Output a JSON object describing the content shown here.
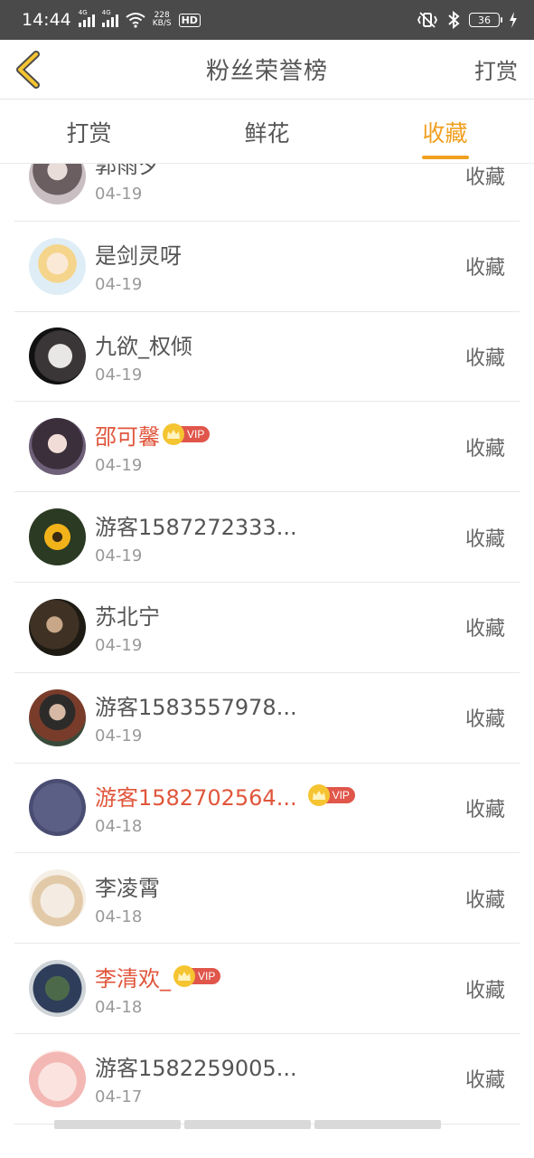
{
  "status_bar": {
    "time": "14:44",
    "sim1": "4G",
    "sim2": "4G",
    "speed_value": "228",
    "speed_unit": "KB/S",
    "hd_label": "HD",
    "battery": "36",
    "icons": [
      "signal-icon",
      "signal-icon",
      "wifi-icon",
      "vibrate-icon",
      "bluetooth-icon",
      "battery-icon",
      "charging-icon"
    ]
  },
  "header": {
    "title": "粉丝荣誉榜",
    "action": "打赏",
    "back_icon": "chevron-left-icon",
    "accent": "#f0a020"
  },
  "tabs": [
    {
      "label": "打赏",
      "active": false
    },
    {
      "label": "鲜花",
      "active": false
    },
    {
      "label": "收藏",
      "active": true
    }
  ],
  "vip_label": "VIP",
  "vip_name_color": "#e0563b",
  "rows": [
    {
      "name": "郭雨夕",
      "date": "04-19",
      "action": "收藏",
      "vip": false
    },
    {
      "name": "是剑灵呀",
      "date": "04-19",
      "action": "收藏",
      "vip": false
    },
    {
      "name": "九欲_权倾",
      "date": "04-19",
      "action": "收藏",
      "vip": false
    },
    {
      "name": "邵可馨",
      "date": "04-19",
      "action": "收藏",
      "vip": true
    },
    {
      "name": "游客1587272333...",
      "date": "04-19",
      "action": "收藏",
      "vip": false
    },
    {
      "name": "苏北宁",
      "date": "04-19",
      "action": "收藏",
      "vip": false
    },
    {
      "name": "游客1583557978...",
      "date": "04-19",
      "action": "收藏",
      "vip": false
    },
    {
      "name": "游客1582702564...",
      "date": "04-18",
      "action": "收藏",
      "vip": true
    },
    {
      "name": "李凌霄",
      "date": "04-18",
      "action": "收藏",
      "vip": false
    },
    {
      "name": "李清欢_",
      "date": "04-18",
      "action": "收藏",
      "vip": true
    },
    {
      "name": "游客1582259005...",
      "date": "04-17",
      "action": "收藏",
      "vip": false
    }
  ]
}
